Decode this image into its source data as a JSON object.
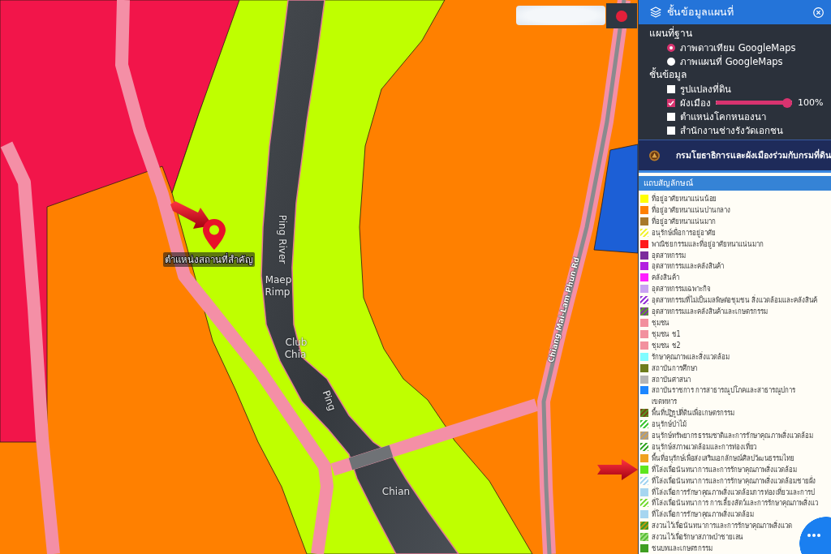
{
  "map": {
    "labels": [
      {
        "text": "Ping River",
        "kind": "place"
      },
      {
        "text": "Maep",
        "kind": "place"
      },
      {
        "text": "Rimp",
        "kind": "place"
      },
      {
        "text": "Club",
        "kind": "place"
      },
      {
        "text": "Chia",
        "kind": "place"
      },
      {
        "text": "Ping",
        "kind": "place"
      },
      {
        "text": "Chian",
        "kind": "place"
      },
      {
        "text": "Chiang Mai-Lam Phun Rd",
        "kind": "road"
      }
    ],
    "marker": {
      "label": "ตำแหน่งสถานที่สำคัญ"
    }
  },
  "panel": {
    "title": "ชั้นข้อมูลแผนที่",
    "sections": [
      {
        "heading": "แผนที่ฐาน",
        "kind": "radio",
        "options": [
          {
            "label": "ภาพดาวเทียม GoogleMaps",
            "selected": true
          },
          {
            "label": "ภาพแผนที่ GoogleMaps",
            "selected": false
          }
        ]
      },
      {
        "heading": "ชั้นข้อมูล",
        "kind": "checkbox",
        "options": [
          {
            "label": "รูปแปลงที่ดิน",
            "checked": false
          },
          {
            "label": "ผังเมือง",
            "checked": true,
            "level": 1,
            "reading": "100%"
          },
          {
            "label": "ตำแหน่งโคกหนองนา",
            "checked": false
          },
          {
            "label": "สำนักงานช่างรังวัดเอกชน",
            "checked": false
          }
        ]
      }
    ],
    "banner": "กรมโยธาธิการและผังเมืองร่วมกับกรมที่ดิน"
  },
  "legend": {
    "title": "แถบสัญลักษณ์",
    "items": [
      {
        "label": "ที่อยู่อาศัยหนาแน่นน้อย",
        "kind": "solid",
        "color": "#ffff00"
      },
      {
        "label": "ที่อยู่อาศัยหนาแน่นปานกลาง",
        "kind": "solid",
        "color": "#ff8000"
      },
      {
        "label": "ที่อยู่อาศัยหนาแน่นมาก",
        "kind": "solid",
        "color": "#a8782a"
      },
      {
        "label": "อนุรักษ์เพื่อการอยู่อาศัย",
        "kind": "hatched",
        "color": "#f2f23a",
        "stripe": {
          "color": "#ffffff"
        }
      },
      {
        "label": "พาณิชยกรรมและที่อยู่อาศัยหนาแน่นมาก",
        "kind": "solid",
        "color": "#ff1a1a"
      },
      {
        "label": "อุตสาหกรรม",
        "kind": "solid",
        "color": "#7b2c9c"
      },
      {
        "label": "อุตสาหกรรมและคลังสินค้า",
        "kind": "solid",
        "color": "#b31fe0"
      },
      {
        "label": "คลังสินค้า",
        "kind": "solid",
        "color": "#ff1fff"
      },
      {
        "label": "อุตสาหกรรมเฉพาะกิจ",
        "kind": "solid",
        "color": "#c9a2f2"
      },
      {
        "label": "อุตสาหกรรมที่ไม่เป็นมลพิษต่อชุมชน สิ่งแวดล้อมและคลังสินค้",
        "kind": "hatched",
        "color": "#9a3ad6",
        "stripe": {
          "color": "#ffffff"
        }
      },
      {
        "label": "อุตสาหกรรมและคลังสินค้าและเกษตรกรรม",
        "kind": "hatched",
        "color": "#7d3a9e",
        "stripe": {
          "color": "#5e9a2e"
        }
      },
      {
        "label": "ชุมชน",
        "kind": "solid",
        "color": "#f2909e"
      },
      {
        "label": "ชุมชน ช1",
        "kind": "solid",
        "color": "#f2909e"
      },
      {
        "label": "ชุมชน ช2",
        "kind": "solid",
        "color": "#f2909e"
      },
      {
        "label": "รักษาคุณภาพและสิ่งแวดล้อม",
        "kind": "solid",
        "color": "#80fcff"
      },
      {
        "label": "สถาบันการศึกษา",
        "kind": "solid",
        "color": "#6e7d1e"
      },
      {
        "label": "สถาบันศาสนา",
        "kind": "solid",
        "color": "#b5b5b5"
      },
      {
        "label": "สถาบันราชการ การสาธารณูปโภคและสาธารณูปการ\nเขตทหาร",
        "kind": "solid",
        "color": "#1c86ff"
      },
      {
        "label": "พื้นที่ปฏิรูปที่ดินเพื่อเกษตรกรรม",
        "kind": "hatched",
        "color": "#7a4a16",
        "stripe": {
          "color": "#5a8f24"
        }
      },
      {
        "label": "อนุรักษ์ป่าไม้",
        "kind": "hatched",
        "color": "#42c83a",
        "stripe": {
          "color": "#ffffff"
        }
      },
      {
        "label": "อนุรักษ์ทรัพยากรธรรมชาติและการรักษาคุณภาพสิ่งแวดล้อม",
        "kind": "hatched",
        "color": "#c9a15c",
        "stripe": {
          "color": "#9e9e9e"
        }
      },
      {
        "label": "อนุรักษ์สภาพแวดล้อมและการท่องเที่ยว",
        "kind": "hatched",
        "color": "#3aa82a",
        "stripe": {
          "color": "#ffffff"
        }
      },
      {
        "label": "พื้นที่อนุรักษ์เพื่อส่งเสริมเอกลักษณ์ศิลปวัฒนธรรมไทย",
        "kind": "solid",
        "color": "#f0a21e"
      },
      {
        "label": "ที่โล่งเพื่อนันทนาการและการรักษาคุณภาพสิ่งแวดล้อม",
        "kind": "solid",
        "color": "#5fe61e"
      },
      {
        "label": "ที่โล่งเพื่อนันทนาการและการรักษาคุณภาพสิ่งแวดล้อมชายฝั่ง",
        "kind": "hatched",
        "color": "#a6d6f0",
        "stripe": {
          "color": "#ffffff"
        }
      },
      {
        "label": "ที่โล่งเพื่อการรักษาคุณภาพสิ่งแวดล้อมการท่องเที่ยวและการป",
        "kind": "solid",
        "color": "#a6d6f0"
      },
      {
        "label": "ที่โล่งเพื่อนันทนาการ การเลี้ยงสัตว์และการรักษาคุณภาพสิ่งแว",
        "kind": "hatched",
        "color": "#7cdc3c",
        "stripe": {
          "color": "#ffffff"
        }
      },
      {
        "label": "ที่โล่งเพื่อการรักษาคุณภาพสิ่งแวดล้อม",
        "kind": "solid",
        "color": "#a6d6f0"
      },
      {
        "label": "สงวนไว้เพื่อนันทนาการและการรักษาคุณภาพสิ่งแวด",
        "kind": "hatched",
        "color": "#b09a10",
        "stripe": {
          "color": "#3e9a2a"
        }
      },
      {
        "label": "สงวนไว้เพื่อรักษาสภาพป่าชายเลน",
        "kind": "hatched",
        "color": "#5cbf3a",
        "stripe": {
          "color": "#9ade7a"
        }
      },
      {
        "label": "ชนบทและเกษตรกรรม",
        "kind": "solid",
        "color": "#3f9e22"
      }
    ]
  }
}
